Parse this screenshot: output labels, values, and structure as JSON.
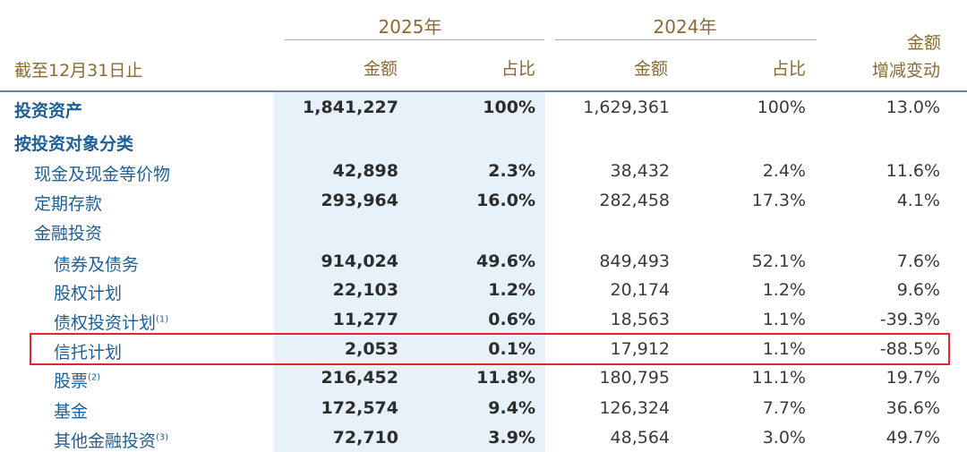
{
  "header": {
    "period_label": "截至12月31日止",
    "year_2025": "2025年",
    "year_2024": "2024年",
    "amount": "金额",
    "share": "占比",
    "change_line1": "金额",
    "change_line2": "增减变动"
  },
  "rows": [
    {
      "label": "投资资产",
      "a25": "1,841,227",
      "p25": "100%",
      "a24": "1,629,361",
      "p24": "100%",
      "chg": "13.0%"
    },
    {
      "label": "按投资对象分类",
      "a25": "",
      "p25": "",
      "a24": "",
      "p24": "",
      "chg": ""
    },
    {
      "label": "现金及现金等价物",
      "a25": "42,898",
      "p25": "2.3%",
      "a24": "38,432",
      "p24": "2.4%",
      "chg": "11.6%"
    },
    {
      "label": "定期存款",
      "a25": "293,964",
      "p25": "16.0%",
      "a24": "282,458",
      "p24": "17.3%",
      "chg": "4.1%"
    },
    {
      "label": "金融投资",
      "a25": "",
      "p25": "",
      "a24": "",
      "p24": "",
      "chg": ""
    },
    {
      "label": "债券及债务",
      "a25": "914,024",
      "p25": "49.6%",
      "a24": "849,493",
      "p24": "52.1%",
      "chg": "7.6%"
    },
    {
      "label": "股权计划",
      "a25": "22,103",
      "p25": "1.2%",
      "a24": "20,174",
      "p24": "1.2%",
      "chg": "9.6%"
    },
    {
      "label": "债权投资计划",
      "sup": "(1)",
      "a25": "11,277",
      "p25": "0.6%",
      "a24": "18,563",
      "p24": "1.1%",
      "chg": "-39.3%"
    },
    {
      "label": "信托计划",
      "a25": "2,053",
      "p25": "0.1%",
      "a24": "17,912",
      "p24": "1.1%",
      "chg": "-88.5%"
    },
    {
      "label": "股票",
      "sup": "(2)",
      "a25": "216,452",
      "p25": "11.8%",
      "a24": "180,795",
      "p24": "11.1%",
      "chg": "19.7%"
    },
    {
      "label": "基金",
      "a25": "172,574",
      "p25": "9.4%",
      "a24": "126,324",
      "p24": "7.7%",
      "chg": "36.6%"
    },
    {
      "label": "其他金融投资",
      "sup": "(3)",
      "a25": "72,710",
      "p25": "3.9%",
      "a24": "48,564",
      "p24": "3.0%",
      "chg": "49.7%"
    }
  ],
  "colors": {
    "header_gold": "#8a6b34",
    "label_blue": "#1f5f96",
    "highlight_column": "#e6f1fa",
    "highlight_box": "#e2262b"
  }
}
